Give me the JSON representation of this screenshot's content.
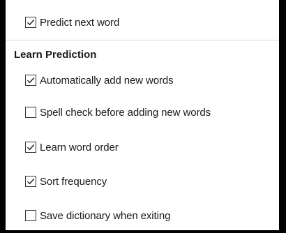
{
  "options_top": [
    {
      "id": "predict-next-word",
      "label": "Predict next word",
      "checked": true
    }
  ],
  "section": {
    "title": "Learn Prediction"
  },
  "options": [
    {
      "id": "auto-add",
      "label": "Automatically add new words",
      "checked": true
    },
    {
      "id": "spell-check",
      "label": "Spell check before adding new words",
      "checked": false
    },
    {
      "id": "learn-order",
      "label": "Learn word order",
      "checked": true
    },
    {
      "id": "sort-frequency",
      "label": "Sort frequency",
      "checked": true
    },
    {
      "id": "save-dictionary",
      "label": "Save dictionary when exiting",
      "checked": false
    }
  ]
}
